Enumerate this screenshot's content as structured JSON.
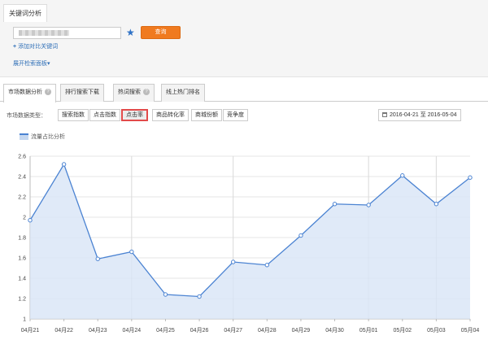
{
  "header": {
    "tab_label": "关键词分析",
    "query_button": "查询",
    "add_link": "添加对比关键词",
    "expand_link": "展开检索面板"
  },
  "tabs": [
    {
      "label": "市场数据分析"
    },
    {
      "label": "排行搜索下载"
    },
    {
      "label": "热词搜索"
    },
    {
      "label": "线上热门排名"
    }
  ],
  "filter": {
    "label": "市场数据类型：",
    "buttons": [
      {
        "label": "搜索指数"
      },
      {
        "label": "点击指数"
      },
      {
        "label": "点击率"
      },
      {
        "label": "商品转化率"
      },
      {
        "label": "商城份额"
      },
      {
        "label": "竞争度"
      }
    ],
    "active_index": 2,
    "date_from": "2016-04-21",
    "date_sep": "至",
    "date_to": "2016-05-04"
  },
  "legend": {
    "label": "流量占比分析"
  },
  "colors": {
    "line": "#4b83d2",
    "fill": "#d8e5f6",
    "accent": "#f07a1f",
    "highlight": "#e24a4a"
  },
  "chart_data": {
    "type": "area",
    "x": [
      "04月21",
      "04月22",
      "04月23",
      "04月24",
      "04月25",
      "04月26",
      "04月27",
      "04月28",
      "04月29",
      "04月30",
      "05月01",
      "05月02",
      "05月03",
      "05月04"
    ],
    "y": [
      1.97,
      2.52,
      1.59,
      1.66,
      1.24,
      1.22,
      1.56,
      1.53,
      1.82,
      2.13,
      2.12,
      2.41,
      2.13,
      2.39
    ],
    "ylim": [
      1.0,
      2.6
    ],
    "yticks": [
      "1",
      "1.2",
      "1.4",
      "1.6",
      "1.8",
      "2",
      "2.2",
      "2.4",
      "2.6"
    ],
    "grid": true
  }
}
